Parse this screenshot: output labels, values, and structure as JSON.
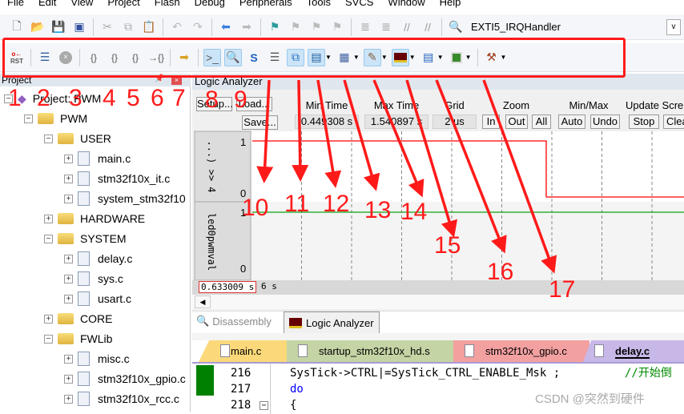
{
  "menu": [
    "File",
    "Edit",
    "View",
    "Project",
    "Flash",
    "Debug",
    "Peripherals",
    "Tools",
    "SVCS",
    "Window",
    "Help"
  ],
  "toolbar1": {
    "icons": [
      "new-file-icon",
      "open-icon",
      "save-icon",
      "save-all-icon",
      "cut-icon",
      "copy-icon",
      "paste-icon",
      "undo-icon",
      "redo-icon",
      "back-icon",
      "forward-icon",
      "bookmark-icon",
      "prev-bookmark-icon",
      "next-bookmark-icon",
      "clear-bookmarks-icon",
      "indent-icon",
      "unindent-icon",
      "comment-icon",
      "uncomment-icon",
      "find-in-files-icon"
    ],
    "function_combo": "EXTI5_IRQHandler"
  },
  "toolbar2": {
    "reset_label": "RST",
    "icons": [
      "reset-icon",
      "run-icon",
      "stop-icon",
      "step-into-icon",
      "step-over-icon",
      "step-out-icon",
      "run-to-cursor-icon",
      "show-next-statement-icon",
      "command-window-icon",
      "disassembly-window-icon",
      "symbols-window-icon",
      "registers-window-icon",
      "call-stack-icon",
      "watch-window-icon",
      "memory-window-icon",
      "serial-window-icon",
      "analysis-window-icon",
      "trace-window-icon",
      "system-viewer-icon",
      "toolbox-icon"
    ]
  },
  "project": {
    "title": "Project",
    "tree": [
      {
        "label": "Project: PWM",
        "level": 0,
        "type": "project",
        "toggle": "−"
      },
      {
        "label": "PWM",
        "level": 1,
        "type": "folder",
        "toggle": "−"
      },
      {
        "label": "USER",
        "level": 2,
        "type": "folder",
        "toggle": "−"
      },
      {
        "label": "main.c",
        "level": 3,
        "type": "file",
        "toggle": "+"
      },
      {
        "label": "stm32f10x_it.c",
        "level": 3,
        "type": "file",
        "toggle": "+"
      },
      {
        "label": "system_stm32f10",
        "level": 3,
        "type": "file",
        "toggle": "+"
      },
      {
        "label": "HARDWARE",
        "level": 2,
        "type": "folder",
        "toggle": "+"
      },
      {
        "label": "SYSTEM",
        "level": 2,
        "type": "folder",
        "toggle": "−"
      },
      {
        "label": "delay.c",
        "level": 3,
        "type": "file",
        "toggle": "+"
      },
      {
        "label": "sys.c",
        "level": 3,
        "type": "file",
        "toggle": "+"
      },
      {
        "label": "usart.c",
        "level": 3,
        "type": "file",
        "toggle": "+"
      },
      {
        "label": "CORE",
        "level": 2,
        "type": "folder",
        "toggle": "+"
      },
      {
        "label": "FWLib",
        "level": 2,
        "type": "folder",
        "toggle": "−"
      },
      {
        "label": "misc.c",
        "level": 3,
        "type": "file",
        "toggle": "+"
      },
      {
        "label": "stm32f10x_gpio.c",
        "level": 3,
        "type": "file",
        "toggle": "+"
      },
      {
        "label": "stm32f10x_rcc.c",
        "level": 3,
        "type": "file",
        "toggle": "+"
      }
    ]
  },
  "logic_analyzer": {
    "title": "Logic Analyzer",
    "setup": "Setup...",
    "load": "Load...",
    "save": "Save...",
    "min_time_label": "Min Time",
    "min_time": "0.449308 s",
    "max_time_label": "Max Time",
    "max_time": "1.540897 s",
    "grid_label": "Grid",
    "grid": "2 us",
    "zoom_label": "Zoom",
    "zoom_in": "In",
    "zoom_out": "Out",
    "zoom_all": "All",
    "minmax_label": "Min/Max",
    "auto": "Auto",
    "undo": "Undo",
    "update_label": "Update Scre",
    "stop": "Stop",
    "clear": "Clea",
    "signals": [
      {
        "name": "...) >> 4",
        "high": "1",
        "low": "0",
        "color": "#ff0000"
      },
      {
        "name": "led0pwmval",
        "high": "1",
        "low": "0",
        "color": "#00a000"
      }
    ],
    "cursor_time": "0.633009 s",
    "cursor_time_behind": "6 s"
  },
  "bottom_tabs": [
    {
      "label": "Disassembly",
      "icon": "disassembly-icon",
      "active": false
    },
    {
      "label": "Logic Analyzer",
      "icon": "logic-analyzer-icon",
      "active": true
    }
  ],
  "file_tabs": [
    {
      "label": "main.c",
      "color": "#fbd97a"
    },
    {
      "label": "startup_stm32f10x_hd.s",
      "color": "#c4d4a4"
    },
    {
      "label": "stm32f10x_gpio.c",
      "color": "#f2a0a0"
    },
    {
      "label": "delay.c",
      "color": "#c8b8e8",
      "active": true
    }
  ],
  "code": [
    {
      "line": "216",
      "text": "SysTick->CTRL|=SysTick_CTRL_ENABLE_Msk ;",
      "comment": "//开始倒"
    },
    {
      "line": "217",
      "text": "do"
    },
    {
      "line": "218",
      "text": "{"
    }
  ],
  "watermark": "CSDN @突然到硬件",
  "annotations": [
    "1",
    "2",
    "3",
    "4",
    "5",
    "6",
    "7",
    "8",
    "9",
    "10",
    "11",
    "12",
    "13",
    "14",
    "15",
    "16",
    "17"
  ],
  "colors": {
    "annotation": "#ff1a1a",
    "active_button": "#cce4f7"
  }
}
